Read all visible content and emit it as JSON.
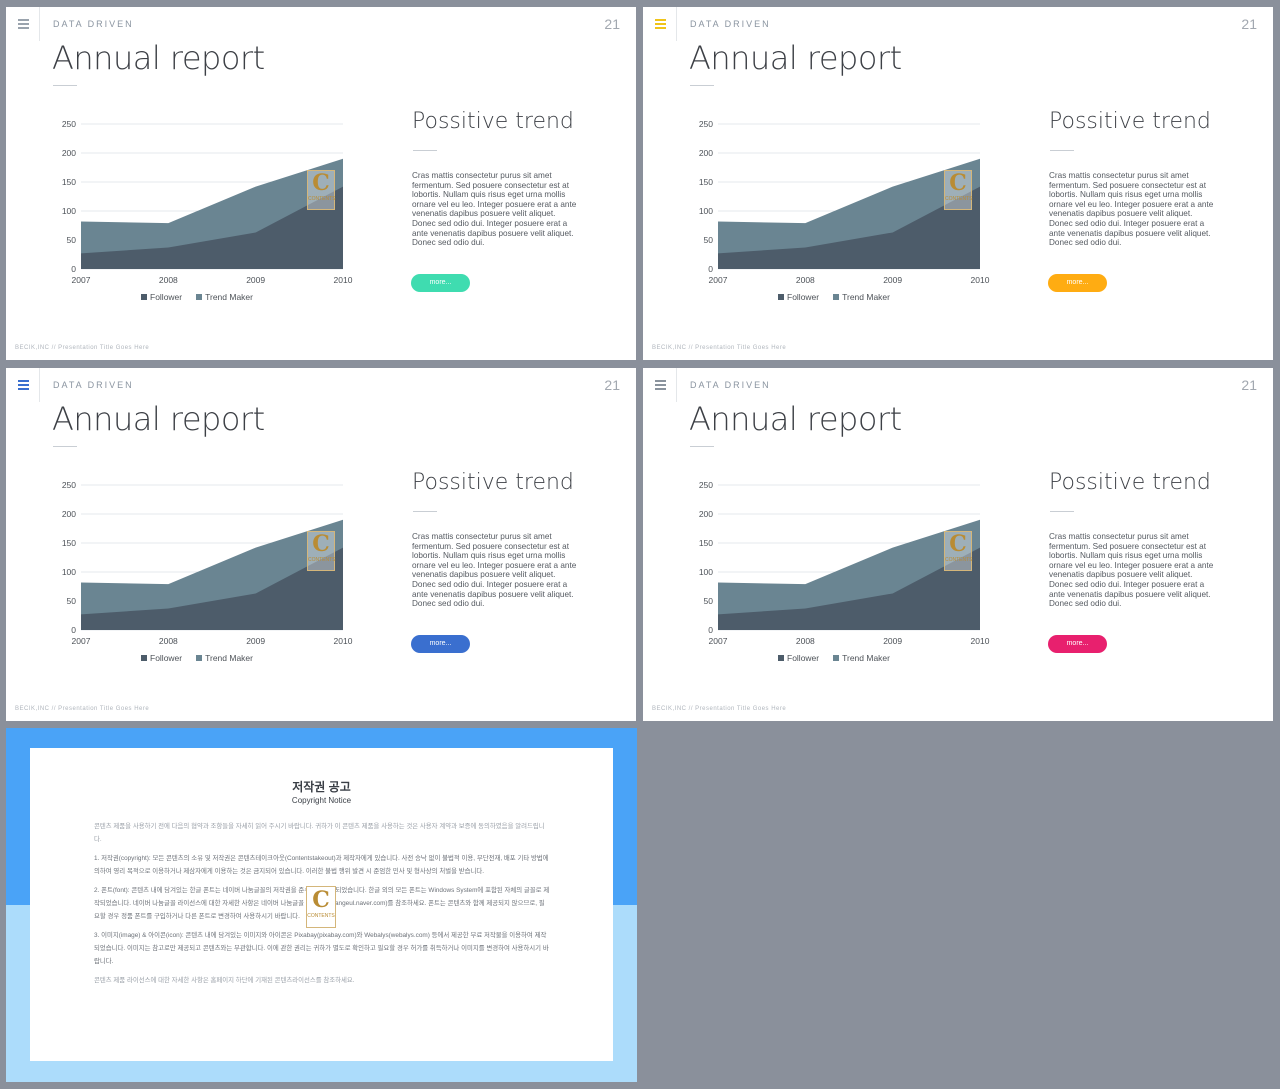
{
  "slides": [
    {
      "section_label": "DATA DRIVEN",
      "page_number": "21",
      "title": "Annual report",
      "trend_title": "Possitive trend",
      "trend_text": "Cras mattis consectetur purus sit amet fermentum. Sed posuere consectetur est at lobortis. Nullam quis risus eget urna mollis ornare vel eu leo. Integer posuere erat a ante venenatis dapibus posuere velit aliquet. Donec sed odio dui. Integer posuere erat a ante venenatis dapibus posuere velit aliquet. Donec sed odio dui.",
      "button_label": "more...",
      "footer": "BECIK,INC  //  Presentation  Title  Goes  Here",
      "accent_color": "#3fdcb0",
      "menu_icon_color": "#9aa3ad"
    },
    {
      "section_label": "DATA DRIVEN",
      "page_number": "21",
      "title": "Annual report",
      "trend_title": "Possitive trend",
      "trend_text": "Cras mattis consectetur purus sit amet fermentum. Sed posuere consectetur est at lobortis. Nullam quis risus eget urna mollis ornare vel eu leo. Integer posuere erat a ante venenatis dapibus posuere velit aliquet. Donec sed odio dui. Integer posuere erat a ante venenatis dapibus posuere velit aliquet. Donec sed odio dui.",
      "button_label": "more...",
      "footer": "BECIK,INC  //  Presentation  Title  Goes  Here",
      "accent_color": "#ffac12",
      "menu_icon_color": "#f0c419"
    },
    {
      "section_label": "DATA DRIVEN",
      "page_number": "21",
      "title": "Annual report",
      "trend_title": "Possitive trend",
      "trend_text": "Cras mattis consectetur purus sit amet fermentum. Sed posuere consectetur est at lobortis. Nullam quis risus eget urna mollis ornare vel eu leo. Integer posuere erat a ante venenatis dapibus posuere velit aliquet. Donec sed odio dui. Integer posuere erat a ante venenatis dapibus posuere velit aliquet. Donec sed odio dui.",
      "button_label": "more...",
      "footer": "BECIK,INC  //  Presentation  Title  Goes  Here",
      "accent_color": "#3a6fcf",
      "menu_icon_color": "#3a6fcf"
    },
    {
      "section_label": "DATA DRIVEN",
      "page_number": "21",
      "title": "Annual report",
      "trend_title": "Possitive trend",
      "trend_text": "Cras mattis consectetur purus sit amet fermentum. Sed posuere consectetur est at lobortis. Nullam quis risus eget urna mollis ornare vel eu leo. Integer posuere erat a ante venenatis dapibus posuere velit aliquet. Donec sed odio dui. Integer posuere erat a ante venenatis dapibus posuere velit aliquet. Donec sed odio dui.",
      "button_label": "more...",
      "footer": "BECIK,INC  //  Presentation  Title  Goes  Here",
      "accent_color": "#e8206e",
      "menu_icon_color": "#8a939d"
    }
  ],
  "brand_mark": {
    "letter": "C",
    "text": "CONTENTS"
  },
  "chart_data": {
    "type": "area",
    "x": [
      "2007",
      "2008",
      "2009",
      "2010"
    ],
    "series": [
      {
        "name": "Follower",
        "values": [
          27,
          37,
          63,
          142
        ],
        "color": "#4d5c6a"
      },
      {
        "name": "Trend Maker",
        "values": [
          82,
          79,
          142,
          190
        ],
        "color": "#6a8592"
      }
    ],
    "ylim": [
      0,
      250
    ],
    "yticks": [
      0,
      50,
      100,
      150,
      200,
      250
    ],
    "grid": true,
    "legend": "bottom"
  },
  "notice": {
    "title": "저작권 공고",
    "subtitle": "Copyright Notice",
    "paragraphs": [
      "콘텐츠 제품을 사용하기 전에 다음의 협약과 조항들을 자세히 읽어 주시기 바랍니다. 귀하가 이 콘텐츠 제품을 사용하는 것은 사용자 계약과 보증에 동의하였음을 알려드립니다.",
      "1. 저작권(copyright): 모든 콘텐츠의 소유 및 저작권은 콘텐츠테이크아웃(Contentstakeout)과 제작자에게 있습니다. 사전 승낙 없이 불법적 이용, 무단전재, 배포 기타 방법에 의하여 영리 목적으로 이용하거나 제삼자에게 이용하는 것은 금지되어 있습니다. 이러한 불법 행위 발견 시 준엄한 민사 및 형사상의 처벌을 받습니다.",
      "2. 폰트(font): 콘텐츠 내에 담겨있는 한글 폰트는 네이버 나눔글꼴의 저작권을 준수하여 제작되었습니다. 한글 외의 모든 폰트는 Windows System에 포함된 자체의 글꼴로 제작되었습니다. 네이버 나눔글꼴 라이선스에 대한 자세한 사항은 네이버 나눔글꼴 홈페이지(hangeul.naver.com)를 참조하세요. 폰트는 콘텐츠와 함께 제공되지 않으므로, 필요할 경우 정품 폰트를 구입하거나 다른 폰트로 변경하여 사용하시기 바랍니다.",
      "3. 이미지(image) & 아이콘(icon): 콘텐츠 내에 담겨있는 이미지와 아이콘은 Pixabay(pixabay.com)와 Webalys(webalys.com) 등에서 제공한 무료 저작물을 이용하여 제작되었습니다. 이미지는 참고로만 제공되고 콘텐츠와는 무관합니다. 이에 관한 권리는 귀하가 별도로 확인하고 필요할 경우 허가를 취득하거나 이미지를 변경하여 사용하시기 바랍니다.",
      "콘텐츠 제품 라이선스에 대한 자세한 사항은 홈페이지 하단에 기재된 콘텐츠라이선스를 참조하세요."
    ]
  }
}
